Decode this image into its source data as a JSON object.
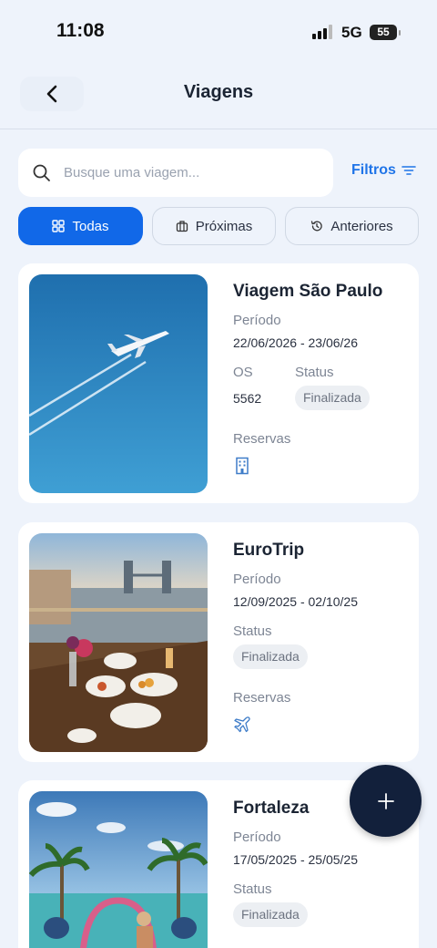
{
  "status_bar": {
    "time": "11:08",
    "network": "5G",
    "battery": "55"
  },
  "header": {
    "title": "Viagens"
  },
  "search": {
    "placeholder": "Busque uma viagem..."
  },
  "filters_label": "Filtros",
  "tabs": [
    {
      "label": "Todas",
      "icon": "grid-icon",
      "active": true
    },
    {
      "label": "Próximas",
      "icon": "luggage-icon",
      "active": false
    },
    {
      "label": "Anteriores",
      "icon": "history-icon",
      "active": false
    }
  ],
  "trips": [
    {
      "title": "Viagem São Paulo",
      "period_label": "Período",
      "period": "22/06/2026 - 23/06/26",
      "os_label": "OS",
      "os": "5562",
      "status_label": "Status",
      "status": "Finalizada",
      "reservations_label": "Reservas",
      "reservation_icon": "building-icon",
      "photo": "airplane-sky"
    },
    {
      "title": "EuroTrip",
      "period_label": "Período",
      "period": "12/09/2025 - 02/10/25",
      "status_label": "Status",
      "status": "Finalizada",
      "reservations_label": "Reservas",
      "reservation_icon": "airplane-icon",
      "photo": "london-breakfast"
    },
    {
      "title": "Fortaleza",
      "period_label": "Período",
      "period": "17/05/2025 - 25/05/25",
      "status_label": "Status",
      "status": "Finalizada",
      "photo": "beach-palms"
    }
  ],
  "colors": {
    "accent": "#1168e8",
    "fab": "#12203b",
    "background": "#eef3fb"
  }
}
